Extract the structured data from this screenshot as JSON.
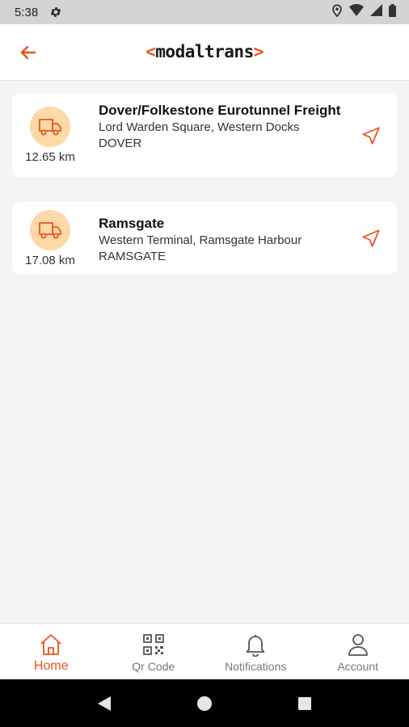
{
  "status_bar": {
    "time": "5:38"
  },
  "app_bar": {
    "logo_prefix": "<",
    "logo_text": "modaltrans",
    "logo_suffix": ">"
  },
  "terminals": [
    {
      "name": "Dover/Folkestone Eurotunnel Freight",
      "address_line1": "Lord Warden Square, Western Docks",
      "address_line2": "DOVER",
      "distance": "12.65 km"
    },
    {
      "name": "Ramsgate",
      "address_line1": "Western Terminal, Ramsgate Harbour",
      "address_line2": "RAMSGATE",
      "distance": "17.08 km"
    }
  ],
  "bottom_nav": [
    {
      "label": "Home",
      "icon": "home-icon",
      "active": true
    },
    {
      "label": "Qr Code",
      "icon": "qr-code-icon",
      "active": false
    },
    {
      "label": "Notifications",
      "icon": "bell-icon",
      "active": false
    },
    {
      "label": "Account",
      "icon": "user-icon",
      "active": false
    }
  ],
  "colors": {
    "accent": "#e8531f",
    "icon_bg": "#fcd9a6",
    "background": "#f4f4f4"
  }
}
